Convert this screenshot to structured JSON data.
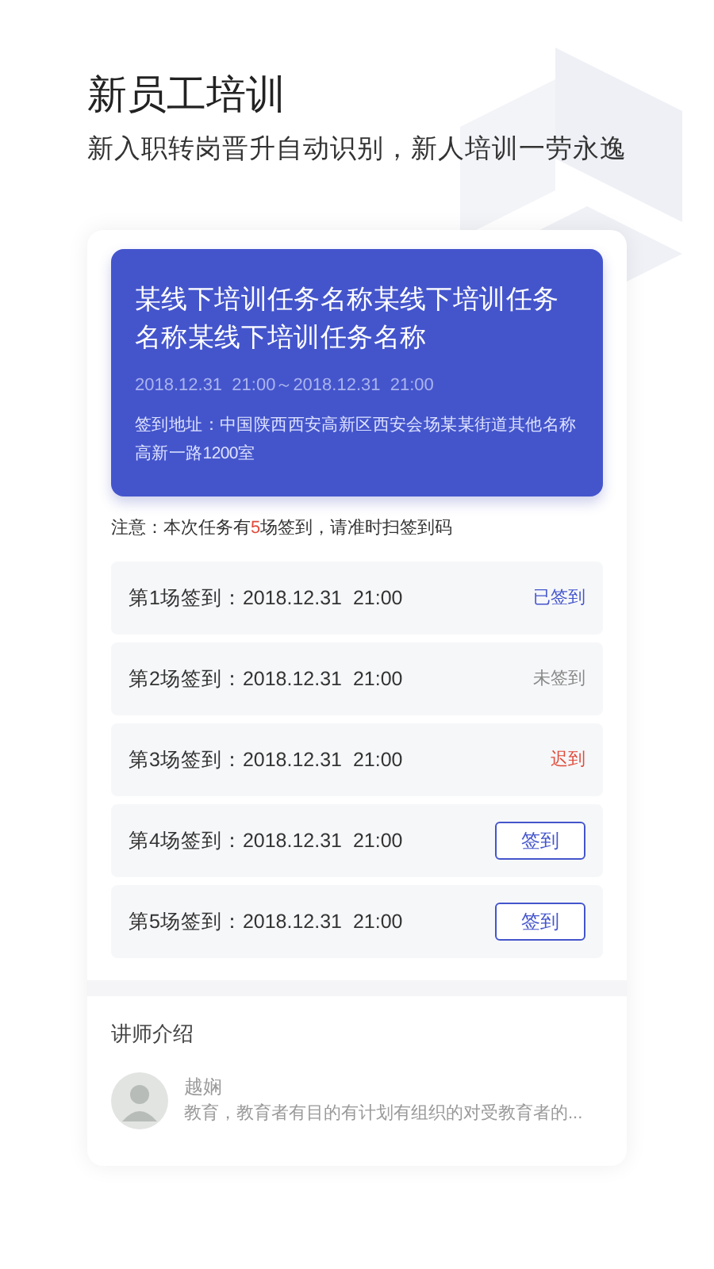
{
  "header": {
    "title": "新员工培训",
    "subtitle": "新入职转岗晋升自动识别，新人培训一劳永逸"
  },
  "task": {
    "title": "某线下培训任务名称某线下培训任务名称某线下培训任务名称",
    "time": "2018.12.31  21:00～2018.12.31  21:00",
    "address": "签到地址：中国陕西西安高新区西安会场某某街道其他名称高新一路1200室"
  },
  "note": {
    "before": "注意：本次任务有",
    "count": "5",
    "after": "场签到，请准时扫签到码"
  },
  "sessions": [
    {
      "label": "第1场签到：2018.12.31  21:00",
      "kind": "signed",
      "status": "已签到"
    },
    {
      "label": "第2场签到：2018.12.31  21:00",
      "kind": "unsigned",
      "status": "未签到"
    },
    {
      "label": "第3场签到：2018.12.31  21:00",
      "kind": "late",
      "status": "迟到"
    },
    {
      "label": "第4场签到：2018.12.31  21:00",
      "kind": "button",
      "status": "签到"
    },
    {
      "label": "第5场签到：2018.12.31  21:00",
      "kind": "button",
      "status": "签到"
    }
  ],
  "instructor": {
    "heading": "讲师介绍",
    "name": "越娴",
    "bio": "教育，教育者有目的有计划有组织的对受教育者的..."
  }
}
